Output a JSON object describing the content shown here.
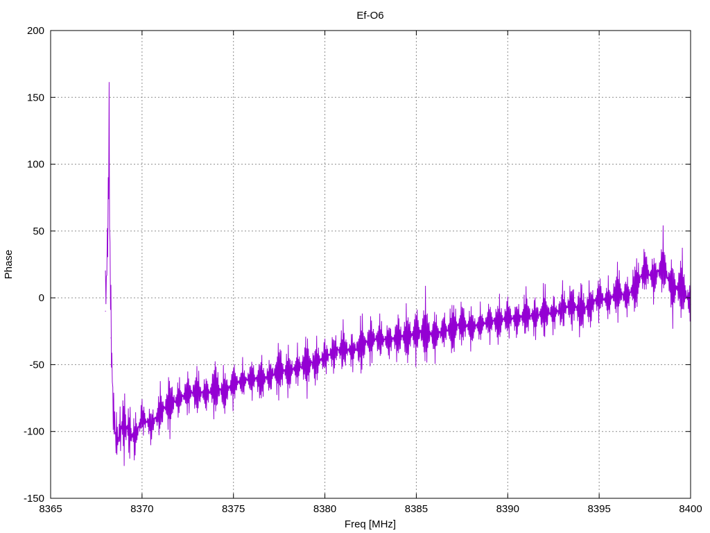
{
  "chart_data": {
    "type": "line",
    "title": "Ef-O6",
    "xlabel": "Freq [MHz]",
    "ylabel": "Phase",
    "xlim": [
      8365,
      8400
    ],
    "ylim": [
      -150,
      200
    ],
    "xticks": [
      8365,
      8370,
      8375,
      8380,
      8385,
      8390,
      8395,
      8400
    ],
    "yticks": [
      -150,
      -100,
      -50,
      0,
      50,
      100,
      150,
      200
    ],
    "xtick_labels": [
      "8365",
      "8370",
      "8375",
      "8380",
      "8385",
      "8390",
      "8395",
      "8400"
    ],
    "ytick_labels": [
      "-150",
      "-100",
      "-50",
      "0",
      "50",
      "100",
      "150",
      "200"
    ],
    "grid": true,
    "series": [
      {
        "color": "#9400d3",
        "x": [
          8368.0,
          8368.1,
          8368.2,
          8368.3,
          8368.45,
          8368.6,
          8368.8,
          8369.0,
          8369.3,
          8369.6,
          8370.0,
          8370.5,
          8371.0,
          8371.5,
          8372.0,
          8372.5,
          8373.0,
          8373.5,
          8374.0,
          8374.5,
          8375.0,
          8375.5,
          8376.0,
          8376.5,
          8377.0,
          8377.5,
          8378.0,
          8378.5,
          8379.0,
          8379.5,
          8380.0,
          8380.5,
          8381.0,
          8381.5,
          8382.0,
          8382.5,
          8383.0,
          8383.5,
          8384.0,
          8384.5,
          8385.0,
          8385.5,
          8386.0,
          8386.5,
          8387.0,
          8387.5,
          8388.0,
          8388.5,
          8389.0,
          8389.5,
          8390.0,
          8390.5,
          8391.0,
          8391.5,
          8392.0,
          8392.5,
          8393.0,
          8393.5,
          8394.0,
          8394.5,
          8395.0,
          8395.5,
          8396.0,
          8396.5,
          8397.0,
          8397.5,
          8398.0,
          8398.5,
          8399.0,
          8399.5,
          8400.0
        ],
        "y": [
          -10,
          40,
          110,
          -30,
          -90,
          -110,
          -100,
          -95,
          -100,
          -105,
          -90,
          -95,
          -85,
          -80,
          -75,
          -72,
          -70,
          -72,
          -68,
          -70,
          -65,
          -62,
          -60,
          -62,
          -58,
          -55,
          -55,
          -52,
          -50,
          -48,
          -45,
          -40,
          -38,
          -40,
          -35,
          -32,
          -30,
          -32,
          -30,
          -28,
          -27,
          -25,
          -28,
          -25,
          -22,
          -20,
          -22,
          -20,
          -18,
          -17,
          -15,
          -16,
          -12,
          -15,
          -10,
          -12,
          -8,
          -5,
          -10,
          -5,
          0,
          -2,
          5,
          0,
          10,
          20,
          15,
          25,
          5,
          10,
          -5
        ],
        "noise": [
          -35,
          30,
          55,
          -45,
          35,
          -30,
          25,
          -40,
          30,
          -25,
          20,
          -20,
          25,
          -30,
          20,
          -22,
          25,
          -20,
          30,
          -25,
          22,
          -18,
          20,
          -25,
          20,
          -30,
          25,
          -20,
          30,
          -25,
          20,
          -22,
          25,
          -20,
          30,
          -25,
          22,
          -20,
          25,
          -30,
          28,
          -35,
          25,
          -20,
          30,
          -25,
          22,
          -18,
          20,
          -25,
          22,
          -20,
          25,
          -22,
          28,
          -20,
          24,
          -26,
          30,
          -25,
          22,
          -20,
          28,
          -22,
          30,
          -25,
          24,
          -30,
          32,
          -35,
          25
        ]
      }
    ]
  }
}
